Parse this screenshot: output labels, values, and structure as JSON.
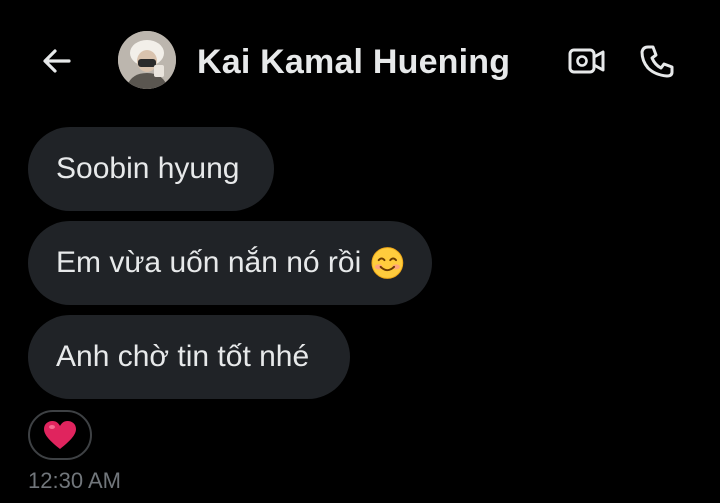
{
  "header": {
    "contact_name": "Kai Kamal Huening",
    "icons": {
      "back": "arrow-left-icon",
      "video": "video-call-icon",
      "phone": "phone-call-icon"
    }
  },
  "messages": [
    {
      "text": "Soobin hyung"
    },
    {
      "text": "Em vừa uốn nắn nó rồi",
      "emoji": "smiling-face-with-smiling-eyes"
    },
    {
      "text": "Anh chờ tin tốt nhé"
    }
  ],
  "reaction": {
    "emoji": "red-heart",
    "color": "#e0245e"
  },
  "timestamp": "12:30 AM",
  "colors": {
    "background": "#000000",
    "bubble": "#202327",
    "text": "#e7e9ea",
    "muted": "#71767b"
  }
}
